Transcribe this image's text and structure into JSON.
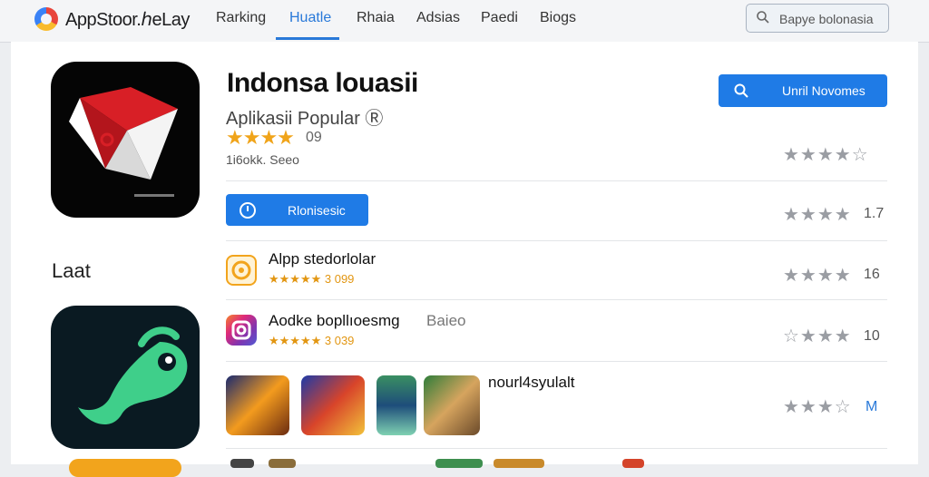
{
  "header": {
    "brand": "AppStoor.ℎeLay",
    "nav": [
      "Rarking",
      "Huatle",
      "Rhaia",
      "Adsias",
      "Paedi",
      "Biogs"
    ],
    "search_text": "Bapye bolonasia"
  },
  "featured": {
    "title": "Indonsa louasii",
    "subtitle": "Aplikasii Popular Ⓡ",
    "rating": "09",
    "downloads": "1i6okk. Seeo",
    "primary_button": "Unril Novomes",
    "secondary_button": "Rlonisesic"
  },
  "sidebar": {
    "label": "Laat"
  },
  "right_column": {
    "items": [
      {
        "stars": "★★★★☆",
        "value": ""
      },
      {
        "stars": "★★★★",
        "value": "1.7"
      },
      {
        "stars": "★★★★",
        "value": "16"
      },
      {
        "stars": "☆★★★",
        "value": "10"
      },
      {
        "stars": "★★★☆",
        "value": "M"
      }
    ]
  },
  "list": {
    "items": [
      {
        "title": "Alpp stedorlolar",
        "rating": "★★★★★ 3 099"
      },
      {
        "title": "Aodke bopll⁠ı⁠oesmg",
        "suffix": "Baieo",
        "rating": "★★★★★ 3 039"
      },
      {
        "title": "nourl4syulalt",
        "rating": ""
      }
    ]
  },
  "colors": {
    "accent": "#1f7be6",
    "star": "#f0a41a",
    "panel": "#ffffff",
    "topbar": "#f4f5f7"
  }
}
